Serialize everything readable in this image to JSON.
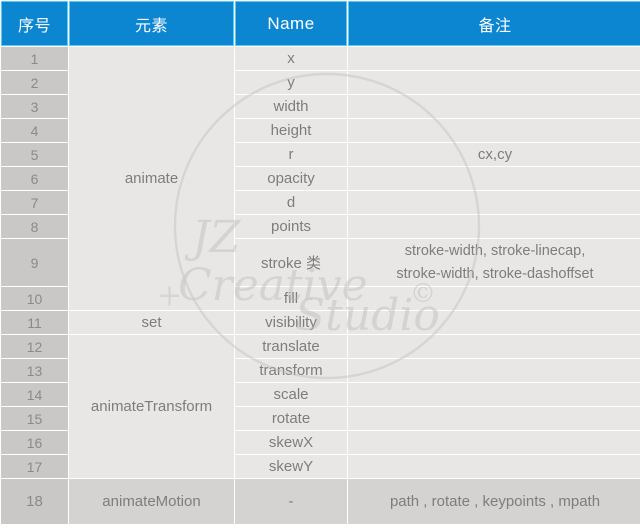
{
  "table": {
    "headers": [
      {
        "label": "序号",
        "name": "column-header-index"
      },
      {
        "label": "元素",
        "name": "column-header-element"
      },
      {
        "label": "Name",
        "name": "column-header-name"
      },
      {
        "label": "备注",
        "name": "column-header-remark"
      }
    ],
    "colors": {
      "header_background": "#0d86d2",
      "header_text": "#ffffff",
      "header_border": "#5ec9e8",
      "index_cell_background": "#c9c8c7",
      "index_cell_text": "#8b8a89",
      "cell_background": "#e9e7e6",
      "cell_text": "#7e7d7c",
      "last_row_background": "#d5d3d2",
      "page_background": "#ffffff"
    },
    "groups": [
      {
        "element": "animate",
        "span": 10
      },
      {
        "element": "set",
        "span": 1
      },
      {
        "element": "animateTransform",
        "span": 6
      },
      {
        "element": "animateMotion",
        "span": 1
      }
    ],
    "rows": [
      {
        "index": "1",
        "name": "x",
        "remark": ""
      },
      {
        "index": "2",
        "name": "y",
        "remark": ""
      },
      {
        "index": "3",
        "name": "width",
        "remark": ""
      },
      {
        "index": "4",
        "name": "height",
        "remark": ""
      },
      {
        "index": "5",
        "name": "r",
        "remark": "cx,cy"
      },
      {
        "index": "6",
        "name": "opacity",
        "remark": ""
      },
      {
        "index": "7",
        "name": "d",
        "remark": ""
      },
      {
        "index": "8",
        "name": "points",
        "remark": ""
      },
      {
        "index": "9",
        "name": "stroke 类",
        "remark_line1": "stroke-width, stroke-linecap,",
        "remark_line2": "stroke-width, stroke-dashoffset"
      },
      {
        "index": "10",
        "name": "fill",
        "remark": ""
      },
      {
        "index": "11",
        "name": "visibility",
        "remark": ""
      },
      {
        "index": "12",
        "name": "translate",
        "remark": ""
      },
      {
        "index": "13",
        "name": "transform",
        "remark": ""
      },
      {
        "index": "14",
        "name": "scale",
        "remark": ""
      },
      {
        "index": "15",
        "name": "rotate",
        "remark": ""
      },
      {
        "index": "16",
        "name": "skewX",
        "remark": ""
      },
      {
        "index": "17",
        "name": "skewY",
        "remark": ""
      },
      {
        "index": "18",
        "name": "-",
        "remark": "path , rotate , keypoints , mpath"
      }
    ]
  },
  "watermark": {
    "line1": "JZ",
    "line2": "Creative",
    "line3": "Studio",
    "copyright": "©",
    "color": "#b9b5b2"
  }
}
